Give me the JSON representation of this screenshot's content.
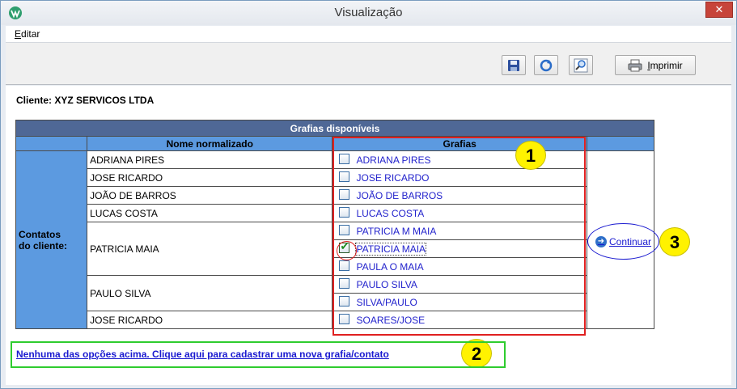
{
  "window": {
    "title": "Visualização",
    "close_glyph": "✕"
  },
  "menu": {
    "edit_first": "E",
    "edit_rest": "ditar"
  },
  "toolbar": {
    "print_first": "I",
    "print_rest": "mprimir",
    "icons": [
      "save-icon",
      "refresh-icon",
      "zoom-icon",
      "printer-icon"
    ]
  },
  "client": {
    "label": "Cliente: XYZ SERVICOS LTDA"
  },
  "table": {
    "title": "Grafias disponíveis",
    "col_name": "Nome normalizado",
    "col_grafias": "Grafias",
    "contacts_label_1": "Contatos",
    "contacts_label_2": "do cliente:",
    "groups": [
      {
        "name": "ADRIANA PIRES",
        "grafias": [
          {
            "text": "ADRIANA PIRES",
            "checked": false
          }
        ]
      },
      {
        "name": "JOSE RICARDO",
        "grafias": [
          {
            "text": "JOSE RICARDO",
            "checked": false
          }
        ]
      },
      {
        "name": "JOÃO DE BARROS",
        "grafias": [
          {
            "text": "JOÃO DE BARROS",
            "checked": false
          }
        ]
      },
      {
        "name": "LUCAS COSTA",
        "grafias": [
          {
            "text": "LUCAS COSTA",
            "checked": false
          }
        ]
      },
      {
        "name": "PATRICIA MAIA",
        "grafias": [
          {
            "text": "PATRICIA M MAIA",
            "checked": false
          },
          {
            "text": "PATRICIA MAIA",
            "checked": true
          },
          {
            "text": "PAULA O MAIA",
            "checked": false
          }
        ]
      },
      {
        "name": "PAULO SILVA",
        "grafias": [
          {
            "text": "PAULO SILVA",
            "checked": false
          },
          {
            "text": "SILVA/PAULO",
            "checked": false
          }
        ]
      },
      {
        "name": "JOSE RICARDO",
        "grafias": [
          {
            "text": "SOARES/JOSE",
            "checked": false
          }
        ]
      }
    ]
  },
  "continue": {
    "label": "Continuar"
  },
  "new_link": {
    "label": "Nenhuma das opções acima. Clique aqui para cadastrar uma nova grafia/contato"
  },
  "annotations": {
    "badge_1": "1",
    "badge_2": "2",
    "badge_3": "3",
    "highlight_colors": {
      "grafias_box": "#e02020",
      "new_link_box": "#2ecc2e",
      "continue_ellipse": "#1a1ad0",
      "badge_fill": "#fff200"
    }
  }
}
